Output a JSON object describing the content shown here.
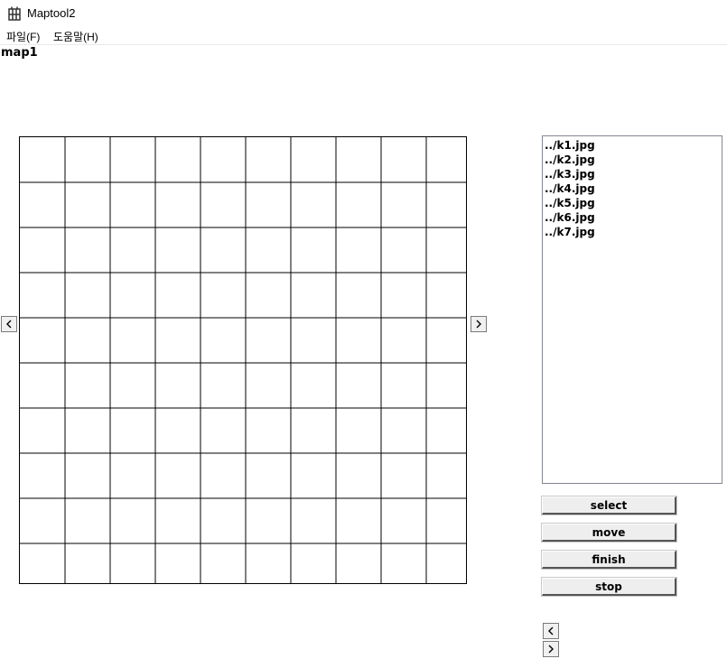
{
  "window": {
    "title": "Maptool2",
    "icon": "app-grid-icon"
  },
  "menu": [
    {
      "label": "파일(F)"
    },
    {
      "label": "도움말(H)"
    }
  ],
  "map": {
    "name": "map1",
    "grid": {
      "rows": 10,
      "cols": 10,
      "visible_cols": 9.9
    }
  },
  "map_scroll": {
    "prev_icon": "chevron-left-icon",
    "next_icon": "chevron-right-icon"
  },
  "file_list": [
    "../k1.jpg",
    "../k2.jpg",
    "../k3.jpg",
    "../k4.jpg",
    "../k5.jpg",
    "../k6.jpg",
    "../k7.jpg"
  ],
  "buttons": {
    "select": "select",
    "move": "move",
    "finish": "finish",
    "stop": "stop"
  },
  "pager": {
    "prev_icon": "chevron-left-icon",
    "next_icon": "chevron-right-icon"
  }
}
